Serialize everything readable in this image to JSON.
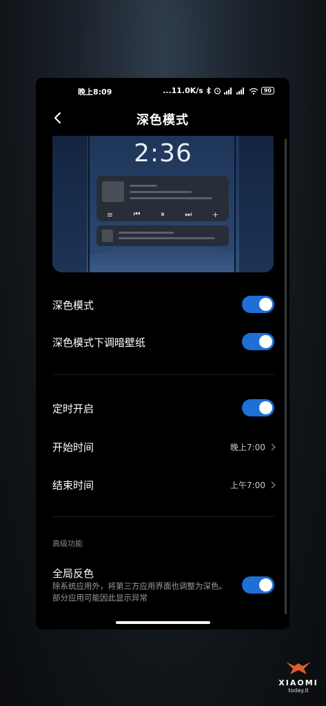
{
  "status_bar": {
    "time": "晚上8:09",
    "network_speed": "...11.0K/s",
    "battery": "90"
  },
  "header": {
    "title": "深色模式"
  },
  "preview": {
    "clock": "2:36"
  },
  "settings": {
    "dark_mode": {
      "label": "深色模式",
      "enabled": true
    },
    "dim_wallpaper": {
      "label": "深色模式下调暗壁纸",
      "enabled": true
    },
    "scheduled": {
      "label": "定时开启",
      "enabled": true
    },
    "start_time": {
      "label": "开始时间",
      "value": "晚上7:00"
    },
    "end_time": {
      "label": "结束时间",
      "value": "上午7:00"
    }
  },
  "advanced": {
    "section_title": "高级功能",
    "invert": {
      "label": "全局反色",
      "description": "除系统应用外，将第三方应用界面也调整为深色。部分应用可能因此显示异常",
      "enabled": true
    }
  },
  "watermark": {
    "brand": "XIAOMI",
    "sub": "today.it"
  },
  "colors": {
    "accent": "#1e6fd6",
    "background": "#000000"
  }
}
